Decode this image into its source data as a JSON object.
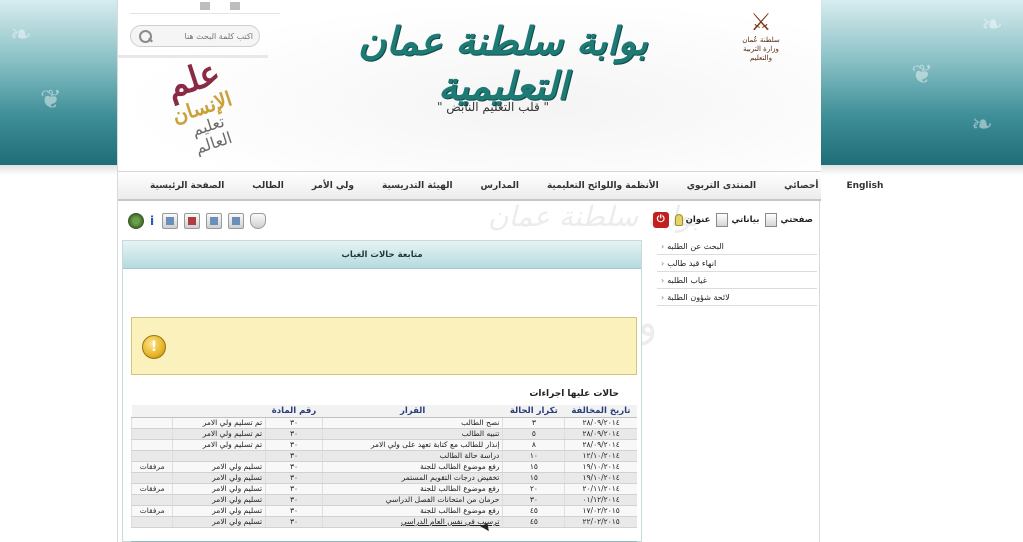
{
  "header": {
    "site_title": "بوابة سلطنة عمان التعليمية",
    "slogan": "\" قلب التعليم النابض \"",
    "emblem_text_1": "سلطنة عُمان",
    "emblem_text_2": "وزارة التربية والتعليم",
    "search_placeholder": "اكتب كلمة البحث هنا",
    "word_cloud": [
      "علم",
      "الإنسان",
      "تعليم",
      "العالم"
    ]
  },
  "nav": {
    "items": [
      {
        "label": "الصفحة الرئيسية"
      },
      {
        "label": "الطالب"
      },
      {
        "label": "ولي الأمر"
      },
      {
        "label": "الهيئة التدريسية"
      },
      {
        "label": "المدارس"
      },
      {
        "label": "الأنظمة واللوائح التعليمية"
      },
      {
        "label": "المنتدى التربوي"
      },
      {
        "label": "أحصائي"
      },
      {
        "label": "English"
      }
    ]
  },
  "toolbar_right": {
    "items": [
      {
        "label": "عنوان",
        "icon": "bulb-icon"
      },
      {
        "label": "بياناتي",
        "icon": "profile-icon"
      },
      {
        "label": "صفحتي",
        "icon": "page-icon"
      }
    ]
  },
  "side_menu": {
    "items": [
      {
        "label": "البحث عن الطلبه"
      },
      {
        "label": "انهاء قيد طالب"
      },
      {
        "label": "غياب الطلبه"
      },
      {
        "label": "لائحة شؤون الطلبة"
      }
    ]
  },
  "content": {
    "panel_title": "متابعة حالات الغياب",
    "section_title": "حالات عليها اجراءات",
    "table": {
      "headers": {
        "date": "تاريخ المخالفة",
        "repeat": "تكرار الحالة",
        "decision": "القرار",
        "article": "رقم المادة",
        "action": "",
        "attach": ""
      },
      "rows": [
        {
          "date": "٢٨/٠٩/٢٠١٤",
          "repeat": "٣",
          "decision": "نصح الطالب",
          "article": "٣٠",
          "action": "تم تسليم ولي الامر",
          "attach": ""
        },
        {
          "date": "٢٨/٠٩/٢٠١٤",
          "repeat": "٥",
          "decision": "تنبيه الطالب",
          "article": "٣٠",
          "action": "تم تسليم ولي الامر",
          "attach": ""
        },
        {
          "date": "٢٨/٠٩/٢٠١٤",
          "repeat": "٨",
          "decision": "إنذار للطالب مع كتابة تعهد على ولي الامر",
          "article": "٣٠",
          "action": "تم تسليم ولي الامر",
          "attach": ""
        },
        {
          "date": "١٢/١٠/٢٠١٤",
          "repeat": "١٠",
          "decision": "دراسة حالة الطالب",
          "article": "٣٠",
          "action": "",
          "attach": ""
        },
        {
          "date": "١٩/١٠/٢٠١٤",
          "repeat": "١٥",
          "decision": "رفع موضوع الطالب للجنة",
          "article": "٣٠",
          "action": "تسليم ولي الامر",
          "attach": "مرفقات"
        },
        {
          "date": "١٩/١٠/٢٠١٤",
          "repeat": "١٥",
          "decision": "تخفيض درجات التقويم المستمر",
          "article": "٣٠",
          "action": "تسليم ولي الامر",
          "attach": ""
        },
        {
          "date": "٢٠/١١/٢٠١٤",
          "repeat": "٢٠",
          "decision": "رفع موضوع الطالب للجنة",
          "article": "٣٠",
          "action": "تسليم ولي الامر",
          "attach": "مرفقات"
        },
        {
          "date": "٠١/١٢/٢٠١٤",
          "repeat": "٣٠",
          "decision": "حرمان من امتحانات الفصل الدراسي",
          "article": "٣٠",
          "action": "تسليم ولي الامر",
          "attach": ""
        },
        {
          "date": "١٧/٠٢/٢٠١٥",
          "repeat": "٤٥",
          "decision": "رفع موضوع الطالب للجنة",
          "article": "٣٠",
          "action": "تسليم ولي الامر",
          "attach": "مرفقات"
        },
        {
          "date": "٢٢/٠٢/٢٠١٥",
          "repeat": "٤٥",
          "decision": "ترسيب في نفس العام الدراسي",
          "article": "٣٠",
          "action": "تسليم ولي الامر",
          "attach": ""
        }
      ]
    }
  }
}
